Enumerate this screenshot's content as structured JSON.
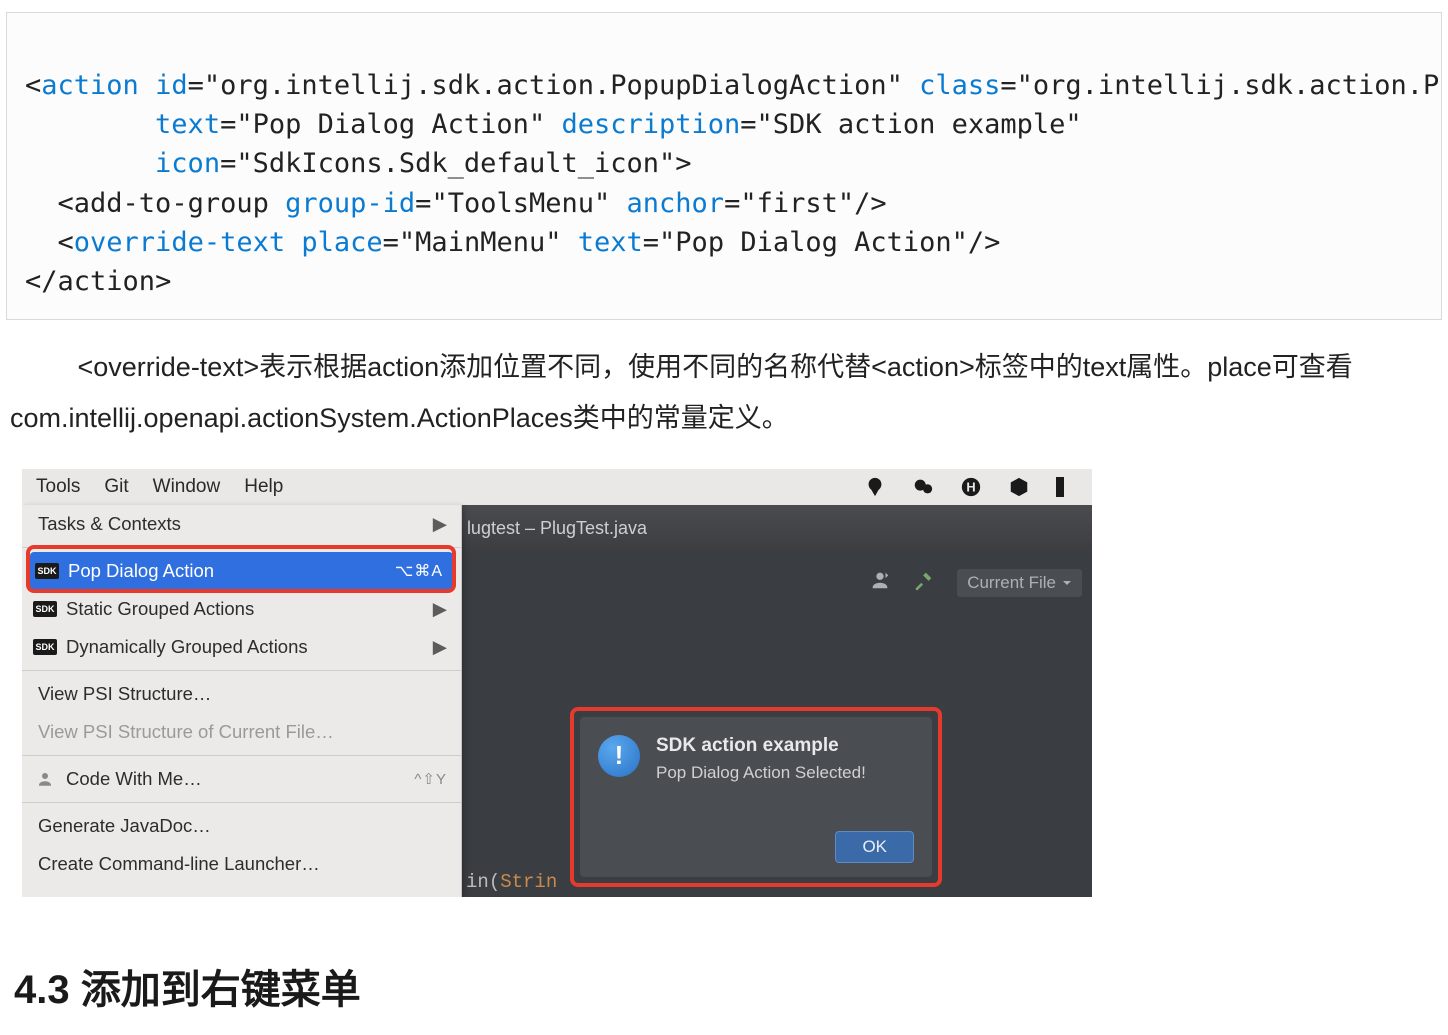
{
  "code": {
    "tag_action_open": "action",
    "attr_id": "id",
    "val_id": "\"org.intellij.sdk.action.PopupDialogAction\"",
    "attr_class": "class",
    "val_class": "\"org.intellij.sdk.action.PopupDialogAction\"",
    "attr_text": "text",
    "val_text": "\"Pop Dialog Action\"",
    "attr_desc": "description",
    "val_desc": "\"SDK action example\"",
    "attr_icon": "icon",
    "val_icon": "\"SdkIcons.Sdk_default_icon\"",
    "tag_addgroup": "add-to-group",
    "attr_groupid": "group-id",
    "val_groupid": "\"ToolsMenu\"",
    "attr_anchor": "anchor",
    "val_anchor": "\"first\"",
    "tag_override": "override-text",
    "attr_place": "place",
    "val_place": "\"MainMenu\"",
    "attr_otext": "text",
    "val_otext": "\"Pop Dialog Action\"",
    "tag_action_close": "action"
  },
  "para": "<override-text>表示根据action添加位置不同，使用不同的名称代替<action>标签中的text属性。place可查看com.intellij.openapi.actionSystem.ActionPlaces类中的常量定义。",
  "menubar": {
    "tools": "Tools",
    "git": "Git",
    "window": "Window",
    "help": "Help"
  },
  "titlebar": "lugtest – PlugTest.java",
  "toolbar": {
    "current_file": "Current File"
  },
  "menu": {
    "tasks": "Tasks & Contexts",
    "pop": "Pop Dialog Action",
    "pop_shortcut": "⌥⌘A",
    "static": "Static Grouped Actions",
    "dynamic": "Dynamically Grouped Actions",
    "psi": "View PSI Structure…",
    "psi_cur": "View PSI Structure of Current File…",
    "cwm": "Code With Me…",
    "cwm_shortcut": "^⇧Y",
    "javadoc": "Generate JavaDoc…",
    "launcher": "Create Command-line Launcher…",
    "sdk_badge": "SDK"
  },
  "dialog": {
    "title": "SDK action example",
    "msg": "Pop Dialog Action Selected!",
    "ok": "OK"
  },
  "sliver": {
    "pn1": "in",
    "pn2": "(",
    "ty": "Strin"
  },
  "heading": "4.3 添加到右键菜单"
}
